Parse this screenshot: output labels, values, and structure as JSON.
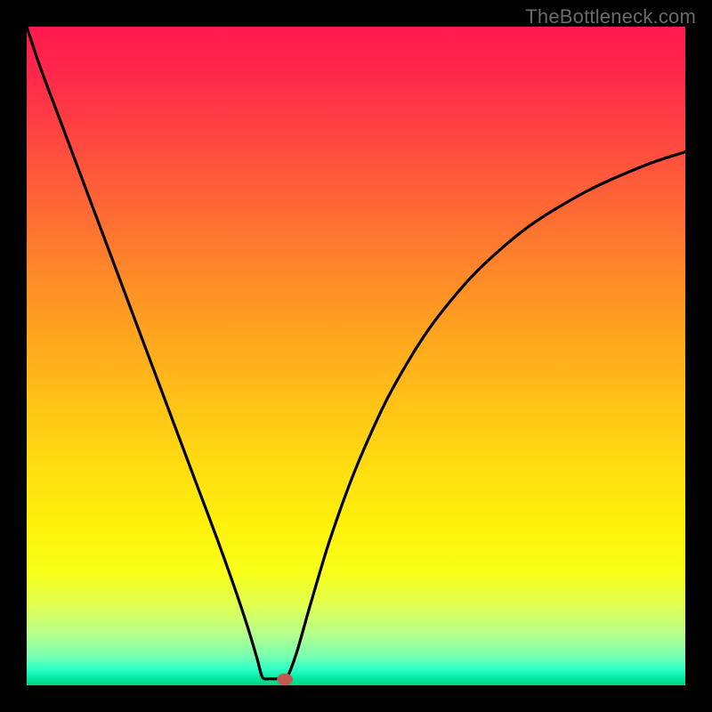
{
  "watermark": "TheBottleneck.com",
  "chart_data": {
    "type": "line",
    "title": "",
    "xlabel": "",
    "ylabel": "",
    "xlim": [
      0,
      100
    ],
    "ylim": [
      0,
      100
    ],
    "series": [
      {
        "name": "left-branch",
        "x": [
          0,
          2,
          5,
          8,
          11,
          14,
          17,
          20,
          23,
          26,
          29,
          31.5,
          33.5,
          35,
          35.8
        ],
        "y": [
          100,
          94,
          86,
          78,
          70,
          62,
          54,
          46,
          38,
          30,
          22,
          15,
          9,
          4,
          1.2
        ]
      },
      {
        "name": "flat-bottom",
        "x": [
          35.8,
          37.0,
          38.2,
          39.5
        ],
        "y": [
          1.2,
          1.0,
          1.0,
          1.2
        ]
      },
      {
        "name": "right-branch",
        "x": [
          39.5,
          41,
          43,
          46,
          50,
          55,
          61,
          68,
          76,
          85,
          94,
          100
        ],
        "y": [
          1.2,
          5,
          12,
          22,
          33,
          44,
          54,
          62.5,
          69.5,
          75,
          79,
          81
        ]
      }
    ],
    "marker": {
      "name": "bottom-dot",
      "x": 39.2,
      "y": 0.9,
      "color": "#c25a4f",
      "rx": 1.2,
      "ry": 0.9
    },
    "background": {
      "type": "vertical-gradient",
      "stops": [
        {
          "pos": 0.0,
          "color": "#ff1a4d"
        },
        {
          "pos": 0.5,
          "color": "#ffb018"
        },
        {
          "pos": 0.8,
          "color": "#fff810"
        },
        {
          "pos": 0.95,
          "color": "#90ff90"
        },
        {
          "pos": 1.0,
          "color": "#00d080"
        }
      ]
    }
  }
}
